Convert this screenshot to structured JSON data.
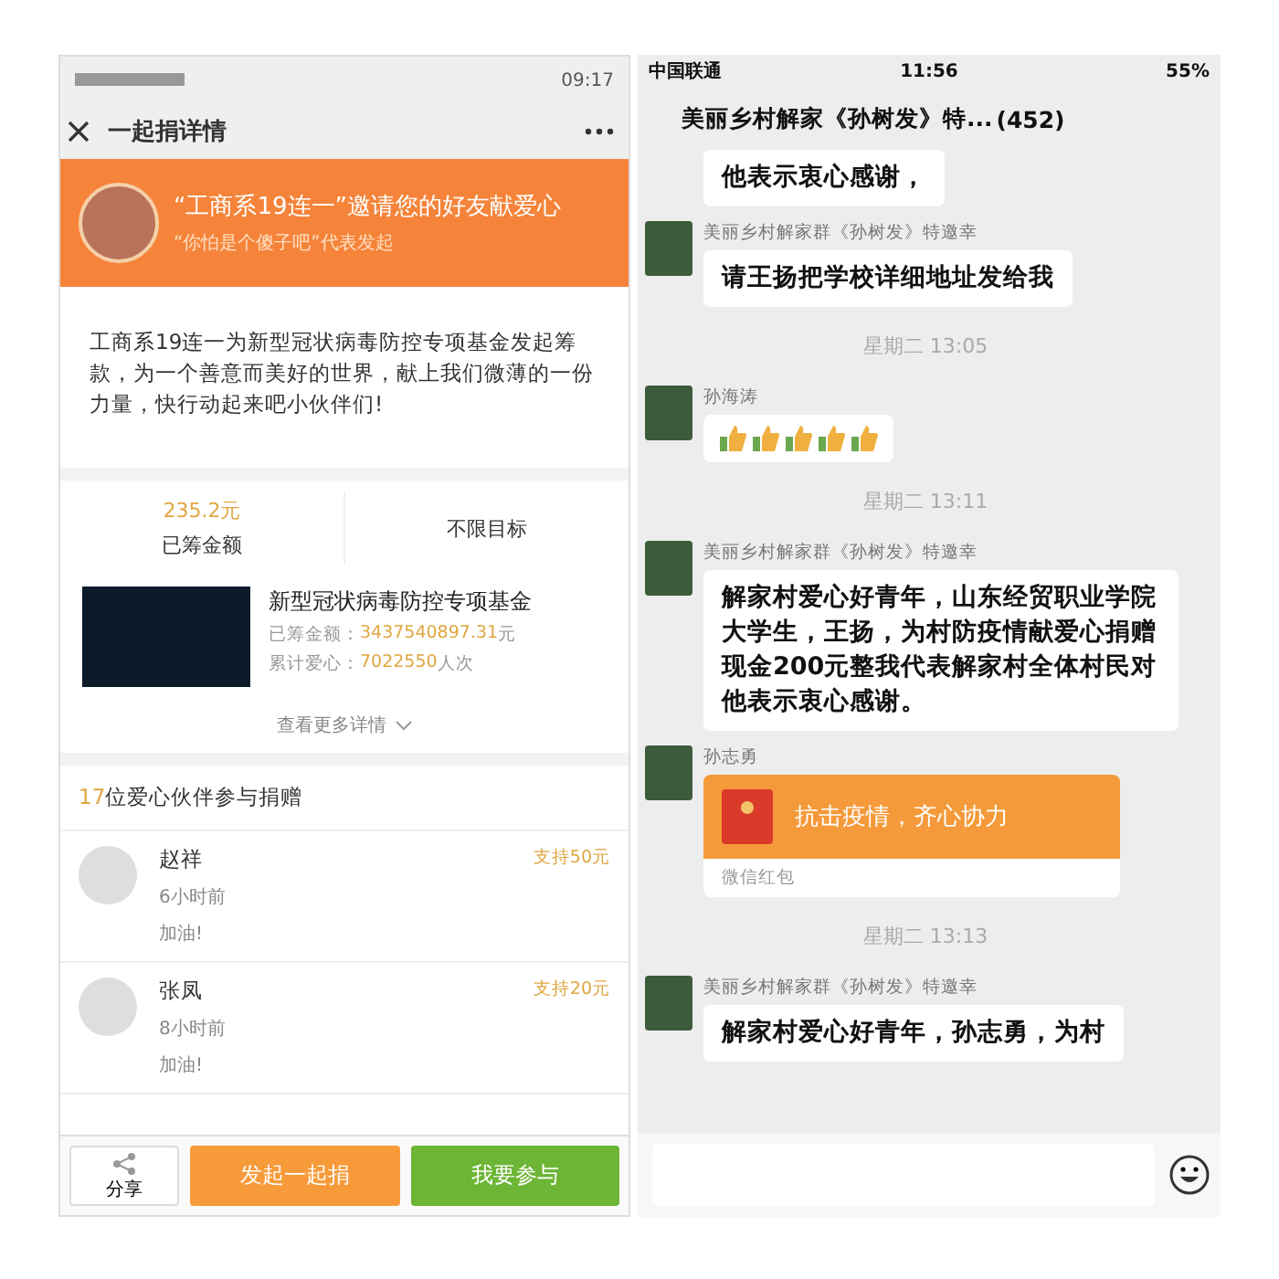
{
  "donation_screen": {
    "status_bar": {
      "time": "09:17"
    },
    "title": "一起捐详情",
    "banner": {
      "headline": "“工商系19连一”邀请您的好友献爱心",
      "subline": "“你怕是个傻子吧”代表发起"
    },
    "description": "工商系19连一为新型冠状病毒防控专项基金发起筹款，为一个善意而美好的世界，献上我们微薄的一份力量，快行动起来吧小伙伴们!",
    "raised": {
      "amount": "235.2元",
      "label": "已筹金额"
    },
    "target": "不限目标",
    "fund": {
      "name": "新型冠状病毒防控专项基金",
      "raised_label": "已筹金额：",
      "raised_value": "3437540897.31",
      "raised_unit": "元",
      "count_label": "累计爱心：",
      "count_value": "7022550",
      "count_unit": "人次"
    },
    "more_link": "查看更多详情",
    "participants": {
      "count": "17",
      "heading": "位爱心伙伴参与捐赠",
      "items": [
        {
          "name": "赵祥",
          "time": "6小时前",
          "message": "加油!",
          "amount": "支持50元"
        },
        {
          "name": "张凤",
          "time": "8小时前",
          "message": "加油!",
          "amount": "支持20元"
        }
      ]
    },
    "buttons": {
      "share": "分享",
      "start": "发起一起捐",
      "join": "我要参与"
    }
  },
  "chat_screen": {
    "status_bar": {
      "carrier": "中国联通",
      "time": "11:56",
      "battery": "55%"
    },
    "title": "美丽乡村解家《孙树发》特...",
    "member_count": "(452)",
    "messages": [
      {
        "kind": "text",
        "text": "他表示衷心感谢，"
      },
      {
        "kind": "text",
        "sender": "美丽乡村解家群《孙树发》特邀幸",
        "text": "请王扬把学校详细地址发给我"
      },
      {
        "kind": "timestamp",
        "text": "星期二 13:05"
      },
      {
        "kind": "sticker",
        "sender": "孙海涛"
      },
      {
        "kind": "timestamp",
        "text": "星期二 13:11"
      },
      {
        "kind": "text",
        "sender": "美丽乡村解家群《孙树发》特邀幸",
        "text": "解家村爱心好青年，山东经贸职业学院大学生，王扬，为村防疫情献爱心捐赠现金200元整我代表解家村全体村民对他表示衷心感谢。"
      },
      {
        "kind": "red_packet",
        "sender": "孙志勇",
        "text": "抗击疫情，齐心协力",
        "footer": "微信红包"
      },
      {
        "kind": "timestamp",
        "text": "星期二 13:13"
      },
      {
        "kind": "text",
        "sender": "美丽乡村解家群《孙树发》特邀幸",
        "text": "解家村爱心好青年，孙志勇，为村"
      }
    ]
  }
}
